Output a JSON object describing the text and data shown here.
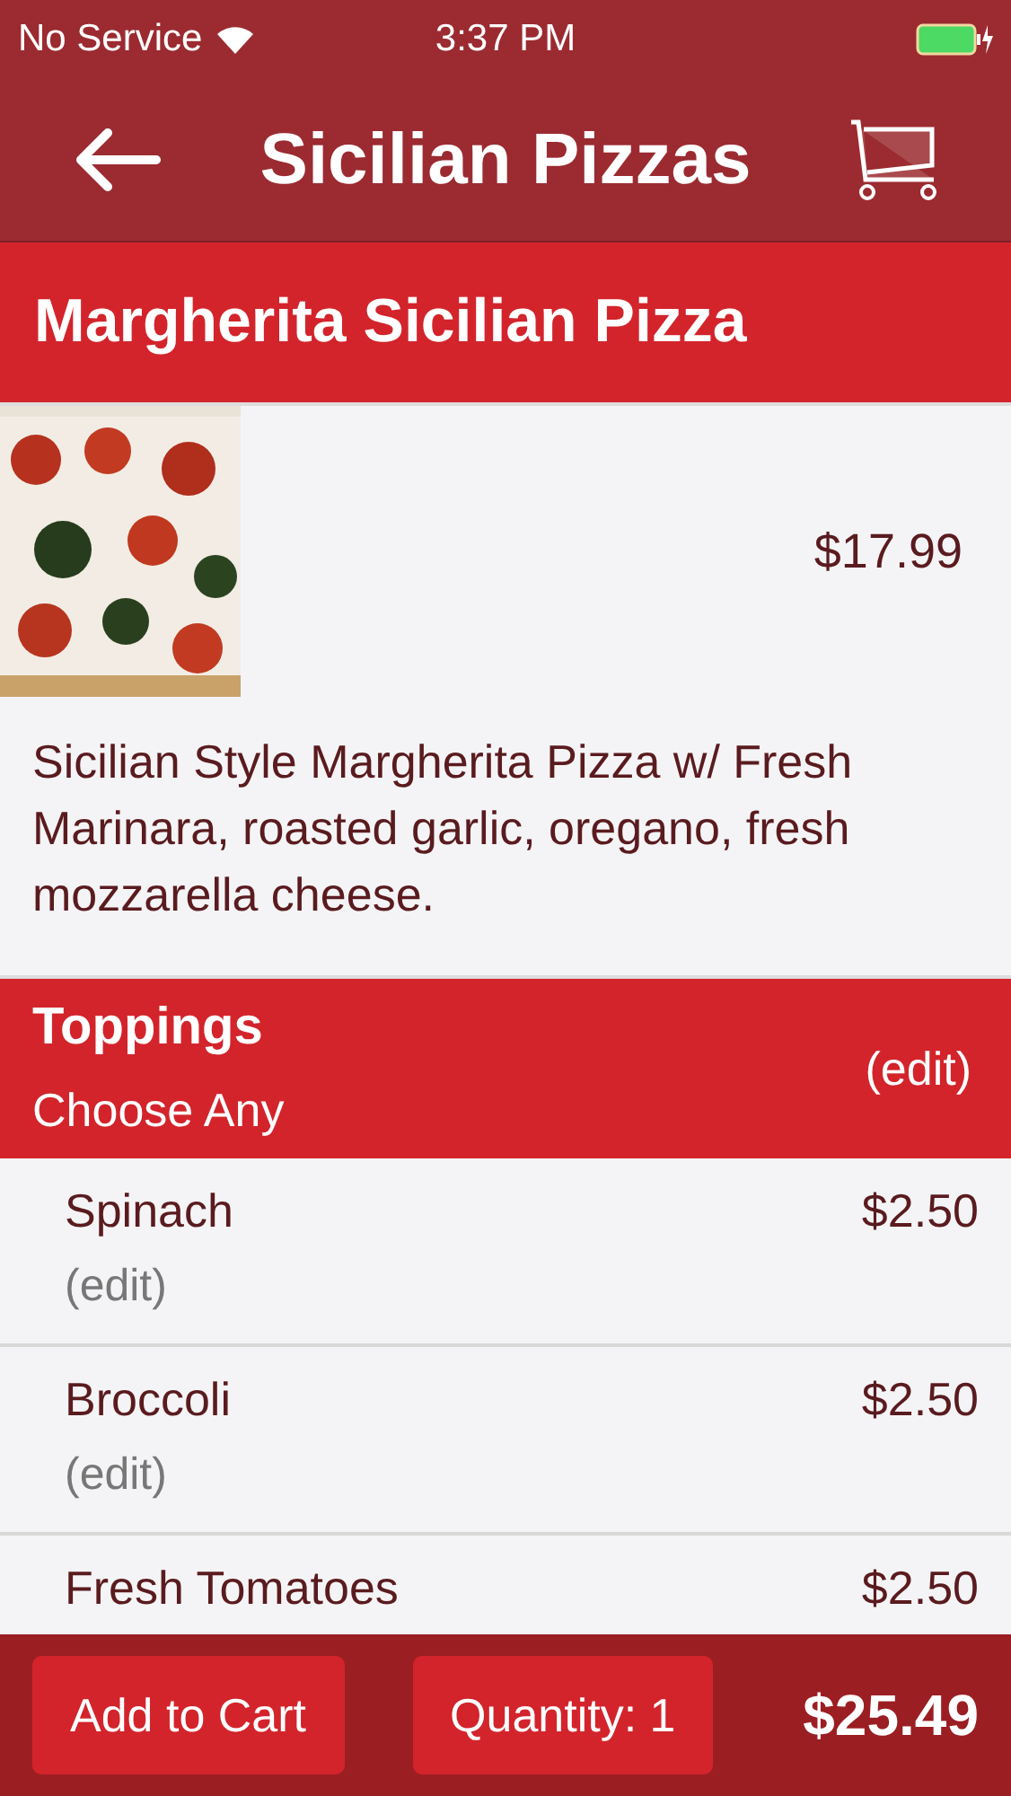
{
  "status_bar": {
    "carrier": "No Service",
    "time": "3:37 PM"
  },
  "nav": {
    "title": "Sicilian Pizzas"
  },
  "product": {
    "name": "Margherita Sicilian Pizza",
    "price": "$17.99",
    "description": "Sicilian Style Margherita Pizza w/ Fresh Marinara, roasted garlic, oregano, fresh mozzarella cheese."
  },
  "toppings_group": {
    "title": "Toppings",
    "subtitle": "Choose Any",
    "action": "(edit)"
  },
  "toppings": [
    {
      "name": "Spinach",
      "price": "$2.50",
      "action": "(edit)"
    },
    {
      "name": "Broccoli",
      "price": "$2.50",
      "action": "(edit)"
    },
    {
      "name": "Fresh Tomatoes",
      "price": "$2.50"
    }
  ],
  "footer": {
    "add_button": "Add to Cart",
    "quantity_button": "Quantity: 1",
    "total": "$25.49"
  }
}
